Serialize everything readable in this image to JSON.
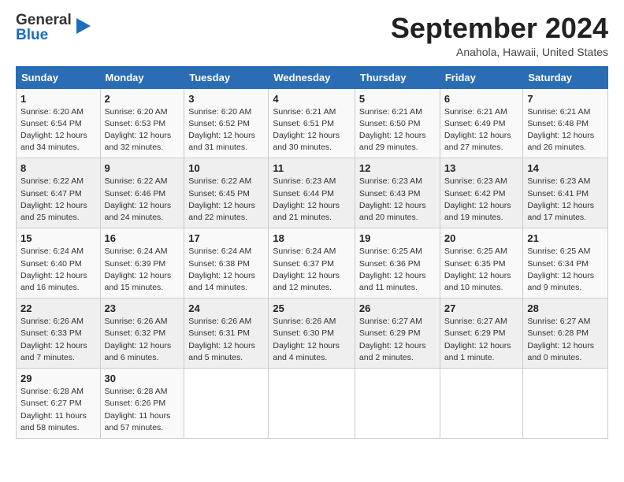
{
  "logo": {
    "general": "General",
    "blue": "Blue"
  },
  "header": {
    "month_title": "September 2024",
    "location": "Anahola, Hawaii, United States"
  },
  "days_of_week": [
    "Sunday",
    "Monday",
    "Tuesday",
    "Wednesday",
    "Thursday",
    "Friday",
    "Saturday"
  ],
  "weeks": [
    [
      {
        "day": "1",
        "sunrise": "6:20 AM",
        "sunset": "6:54 PM",
        "daylight": "12 hours and 34 minutes."
      },
      {
        "day": "2",
        "sunrise": "6:20 AM",
        "sunset": "6:53 PM",
        "daylight": "12 hours and 32 minutes."
      },
      {
        "day": "3",
        "sunrise": "6:20 AM",
        "sunset": "6:52 PM",
        "daylight": "12 hours and 31 minutes."
      },
      {
        "day": "4",
        "sunrise": "6:21 AM",
        "sunset": "6:51 PM",
        "daylight": "12 hours and 30 minutes."
      },
      {
        "day": "5",
        "sunrise": "6:21 AM",
        "sunset": "6:50 PM",
        "daylight": "12 hours and 29 minutes."
      },
      {
        "day": "6",
        "sunrise": "6:21 AM",
        "sunset": "6:49 PM",
        "daylight": "12 hours and 27 minutes."
      },
      {
        "day": "7",
        "sunrise": "6:21 AM",
        "sunset": "6:48 PM",
        "daylight": "12 hours and 26 minutes."
      }
    ],
    [
      {
        "day": "8",
        "sunrise": "6:22 AM",
        "sunset": "6:47 PM",
        "daylight": "12 hours and 25 minutes."
      },
      {
        "day": "9",
        "sunrise": "6:22 AM",
        "sunset": "6:46 PM",
        "daylight": "12 hours and 24 minutes."
      },
      {
        "day": "10",
        "sunrise": "6:22 AM",
        "sunset": "6:45 PM",
        "daylight": "12 hours and 22 minutes."
      },
      {
        "day": "11",
        "sunrise": "6:23 AM",
        "sunset": "6:44 PM",
        "daylight": "12 hours and 21 minutes."
      },
      {
        "day": "12",
        "sunrise": "6:23 AM",
        "sunset": "6:43 PM",
        "daylight": "12 hours and 20 minutes."
      },
      {
        "day": "13",
        "sunrise": "6:23 AM",
        "sunset": "6:42 PM",
        "daylight": "12 hours and 19 minutes."
      },
      {
        "day": "14",
        "sunrise": "6:23 AM",
        "sunset": "6:41 PM",
        "daylight": "12 hours and 17 minutes."
      }
    ],
    [
      {
        "day": "15",
        "sunrise": "6:24 AM",
        "sunset": "6:40 PM",
        "daylight": "12 hours and 16 minutes."
      },
      {
        "day": "16",
        "sunrise": "6:24 AM",
        "sunset": "6:39 PM",
        "daylight": "12 hours and 15 minutes."
      },
      {
        "day": "17",
        "sunrise": "6:24 AM",
        "sunset": "6:38 PM",
        "daylight": "12 hours and 14 minutes."
      },
      {
        "day": "18",
        "sunrise": "6:24 AM",
        "sunset": "6:37 PM",
        "daylight": "12 hours and 12 minutes."
      },
      {
        "day": "19",
        "sunrise": "6:25 AM",
        "sunset": "6:36 PM",
        "daylight": "12 hours and 11 minutes."
      },
      {
        "day": "20",
        "sunrise": "6:25 AM",
        "sunset": "6:35 PM",
        "daylight": "12 hours and 10 minutes."
      },
      {
        "day": "21",
        "sunrise": "6:25 AM",
        "sunset": "6:34 PM",
        "daylight": "12 hours and 9 minutes."
      }
    ],
    [
      {
        "day": "22",
        "sunrise": "6:26 AM",
        "sunset": "6:33 PM",
        "daylight": "12 hours and 7 minutes."
      },
      {
        "day": "23",
        "sunrise": "6:26 AM",
        "sunset": "6:32 PM",
        "daylight": "12 hours and 6 minutes."
      },
      {
        "day": "24",
        "sunrise": "6:26 AM",
        "sunset": "6:31 PM",
        "daylight": "12 hours and 5 minutes."
      },
      {
        "day": "25",
        "sunrise": "6:26 AM",
        "sunset": "6:30 PM",
        "daylight": "12 hours and 4 minutes."
      },
      {
        "day": "26",
        "sunrise": "6:27 AM",
        "sunset": "6:29 PM",
        "daylight": "12 hours and 2 minutes."
      },
      {
        "day": "27",
        "sunrise": "6:27 AM",
        "sunset": "6:29 PM",
        "daylight": "12 hours and 1 minute."
      },
      {
        "day": "28",
        "sunrise": "6:27 AM",
        "sunset": "6:28 PM",
        "daylight": "12 hours and 0 minutes."
      }
    ],
    [
      {
        "day": "29",
        "sunrise": "6:28 AM",
        "sunset": "6:27 PM",
        "daylight": "11 hours and 58 minutes."
      },
      {
        "day": "30",
        "sunrise": "6:28 AM",
        "sunset": "6:26 PM",
        "daylight": "11 hours and 57 minutes."
      },
      null,
      null,
      null,
      null,
      null
    ]
  ],
  "labels": {
    "sunrise": "Sunrise: ",
    "sunset": "Sunset: ",
    "daylight": "Daylight: "
  }
}
